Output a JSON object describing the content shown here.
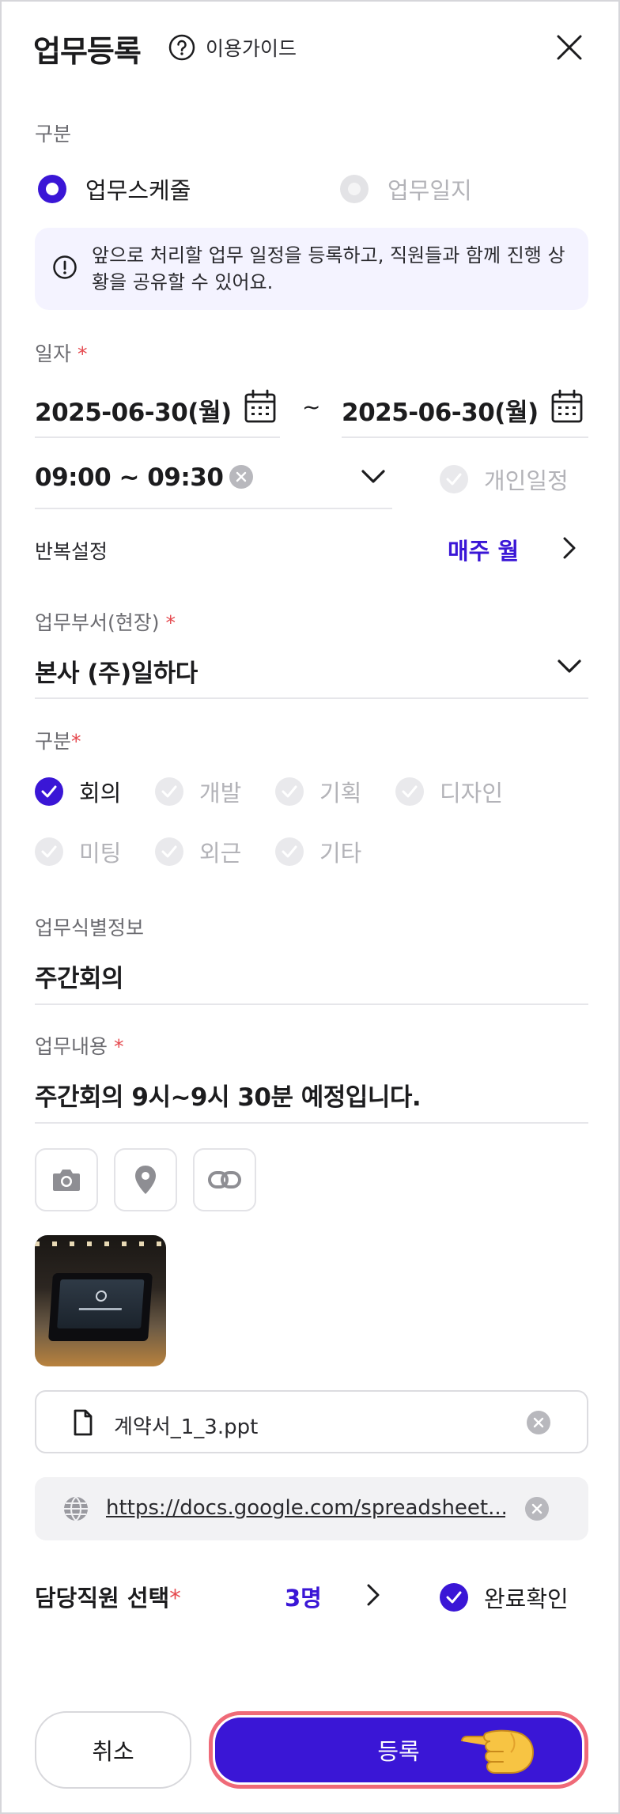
{
  "header": {
    "title": "업무등록",
    "guide_label": "이용가이드"
  },
  "type_section": {
    "label": "구분",
    "options": [
      {
        "label": "업무스케줄",
        "selected": true
      },
      {
        "label": "업무일지",
        "selected": false
      }
    ],
    "notice": "앞으로 처리할 업무 일정을 등록하고, 직원들과 함께 진행 상황을 공유할 수 있어요."
  },
  "date_section": {
    "label": "일자",
    "required_mark": "*",
    "start_date": "2025-06-30(월)",
    "separator": "~",
    "end_date": "2025-06-30(월)",
    "time_range": "09:00 ~ 09:30",
    "personal_schedule_label": "개인일정"
  },
  "repeat": {
    "label": "반복설정",
    "value": "매주 월"
  },
  "department": {
    "label": "업무부서(현장)",
    "required_mark": "*",
    "value": "본사 (주)일하다"
  },
  "category": {
    "label": "구분",
    "required_mark": "*",
    "options": [
      {
        "label": "회의",
        "checked": true
      },
      {
        "label": "개발",
        "checked": false
      },
      {
        "label": "기획",
        "checked": false
      },
      {
        "label": "디자인",
        "checked": false
      },
      {
        "label": "미팅",
        "checked": false
      },
      {
        "label": "외근",
        "checked": false
      },
      {
        "label": "기타",
        "checked": false
      }
    ]
  },
  "identifier": {
    "label": "업무식별정보",
    "value": "주간회의"
  },
  "content": {
    "label": "업무내용",
    "required_mark": "*",
    "value": "주간회의 9시~9시 30분 예정입니다."
  },
  "attachments": {
    "file_name": "계약서_1_3.ppt",
    "link_url": "https://docs.google.com/spreadsheet..."
  },
  "assignee": {
    "label": "담당직원 선택",
    "required_mark": "*",
    "count": "3명",
    "complete_label": "완료확인"
  },
  "footer": {
    "cancel_label": "취소",
    "submit_label": "등록"
  },
  "colors": {
    "accent": "#3a16d6",
    "required": "#e5484d",
    "highlight_border": "#ef6a78"
  }
}
